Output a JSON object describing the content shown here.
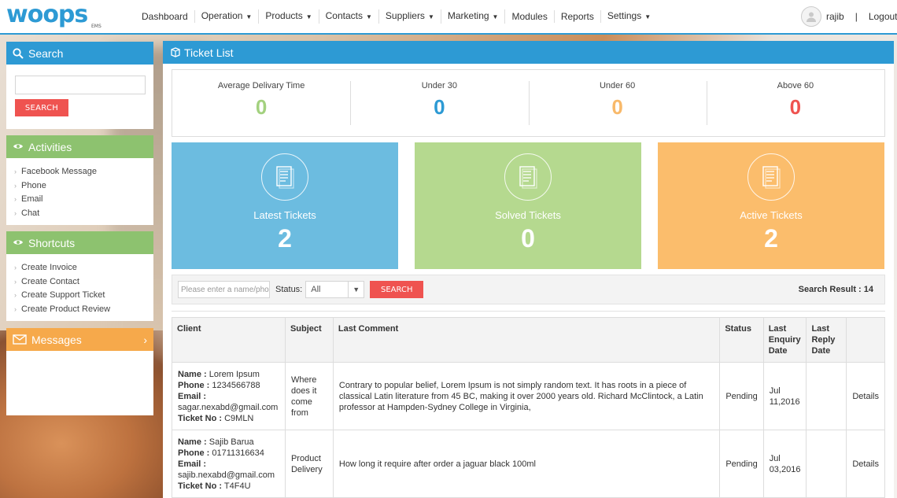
{
  "brand": {
    "logo": "woops",
    "sub": "EMS"
  },
  "nav": [
    {
      "label": "Dashboard",
      "dropdown": false
    },
    {
      "label": "Operation",
      "dropdown": true
    },
    {
      "label": "Products",
      "dropdown": true
    },
    {
      "label": "Contacts",
      "dropdown": true
    },
    {
      "label": "Suppliers",
      "dropdown": true
    },
    {
      "label": "Marketing",
      "dropdown": true
    },
    {
      "label": "Modules",
      "dropdown": false
    },
    {
      "label": "Reports",
      "dropdown": false
    },
    {
      "label": "Settings",
      "dropdown": true
    }
  ],
  "user": {
    "name": "rajib",
    "separator": "|",
    "logout": "Logout"
  },
  "sidebar": {
    "search": {
      "title": "Search",
      "button": "SEARCH"
    },
    "activities": {
      "title": "Activities",
      "items": [
        "Facebook Message",
        "Phone",
        "Email",
        "Chat"
      ]
    },
    "shortcuts": {
      "title": "Shortcuts",
      "items": [
        "Create Invoice",
        "Create Contact",
        "Create Support Ticket",
        "Create Product Review"
      ]
    },
    "messages": {
      "title": "Messages"
    }
  },
  "main": {
    "title": "Ticket List",
    "stats": [
      {
        "label": "Average Delivary Time",
        "value": "0",
        "color": "#a3d17f"
      },
      {
        "label": "Under 30",
        "value": "0",
        "color": "#2d9ad4"
      },
      {
        "label": "Under 60",
        "value": "0",
        "color": "#f8b96a"
      },
      {
        "label": "Above 60",
        "value": "0",
        "color": "#ef5350"
      }
    ],
    "tiles": [
      {
        "label": "Latest Tickets",
        "value": "2",
        "color": "#6cbce0"
      },
      {
        "label": "Solved Tickets",
        "value": "0",
        "color": "#b5d98f"
      },
      {
        "label": "Active Tickets",
        "value": "2",
        "color": "#fbbd6c"
      }
    ],
    "filter": {
      "placeholder": "Please enter a name/phone",
      "status_label": "Status:",
      "status_value": "All",
      "button": "SEARCH",
      "result": "Search Result : 14"
    },
    "table": {
      "headers": [
        "Client",
        "Subject",
        "Last Comment",
        "Status",
        "Last Enquiry Date",
        "Last Reply Date",
        ""
      ],
      "field_labels": {
        "name": "Name :",
        "phone": "Phone :",
        "email": "Email :",
        "ticket": "Ticket No :"
      },
      "rows": [
        {
          "name": "Lorem Ipsum",
          "phone": "1234566788",
          "email": "sagar.nexabd@gmail.com",
          "ticket": "C9MLN",
          "subject": "Where does it come from",
          "comment": "Contrary to popular belief, Lorem Ipsum is not simply random text. It has roots in a piece of classical Latin literature from 45 BC, making it over 2000 years old. Richard McClintock, a Latin professor at Hampden-Sydney College in Virginia,",
          "status": "Pending",
          "enquiry": "Jul 11,2016",
          "reply": "",
          "action": "Details"
        },
        {
          "name": "Sajib Barua",
          "phone": "01711316634",
          "email": "sajib.nexabd@gmail.com",
          "ticket": "T4F4U",
          "subject": "Product Delivery",
          "comment": "How long it require after order a jaguar black 100ml",
          "status": "Pending",
          "enquiry": "Jul 03,2016",
          "reply": "",
          "action": "Details"
        }
      ]
    }
  }
}
